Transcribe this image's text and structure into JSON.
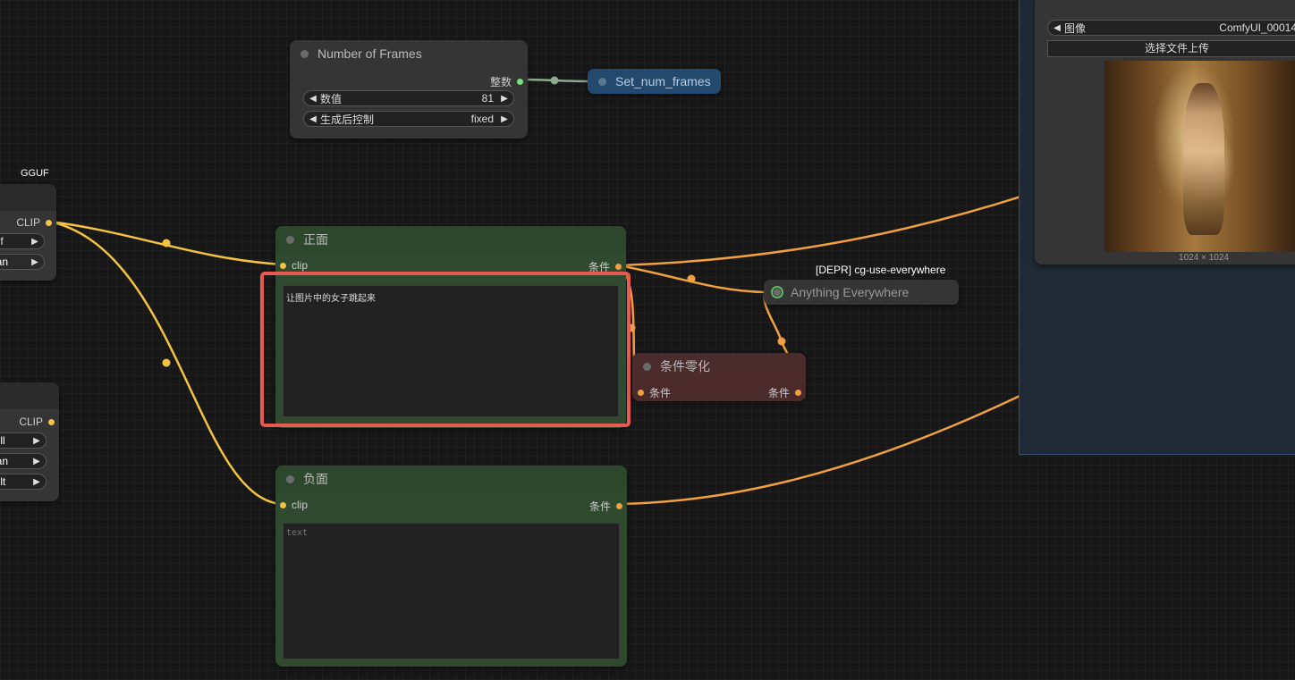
{
  "colors": {
    "background": "#171717",
    "node_gray": "#353535",
    "node_green": "#2f4a2f",
    "node_red": "#4a2a2a",
    "node_blue": "#234a6e",
    "wire_clip": "#f5c342",
    "wire_cond": "#f0a040",
    "highlight": "#e85a4f",
    "group_bg": "#1f2a36"
  },
  "left_node_top": {
    "title": "GGUF",
    "output_label": "CLIP",
    "widgets": [
      {
        "value": "guf"
      },
      {
        "value": "wan"
      }
    ]
  },
  "left_node_bottom": {
    "output_label": "CLIP",
    "widgets": [
      {
        "value": "null"
      },
      {
        "value": "wan"
      },
      {
        "value": "ault"
      }
    ]
  },
  "frames_node": {
    "title": "Number of Frames",
    "output_label": "整数",
    "widgets": [
      {
        "name": "数值",
        "value": "81"
      },
      {
        "name": "生成后控制",
        "value": "fixed"
      }
    ]
  },
  "set_node": {
    "title": "Set_num_frames"
  },
  "positive_node": {
    "title": "正面",
    "input_label": "clip",
    "output_label": "条件",
    "text": "让图片中的女子跳起来"
  },
  "negative_node": {
    "title": "负面",
    "input_label": "clip",
    "output_label": "条件",
    "placeholder": "text"
  },
  "zero_node": {
    "title": "条件零化",
    "input_label": "条件",
    "output_label": "条件"
  },
  "everywhere_node": {
    "badge": "[DEPR] cg-use-everywhere",
    "title": "Anything Everywhere"
  },
  "image_node": {
    "widget_name": "图像",
    "widget_value": "ComfyUI_00014",
    "upload_label": "选择文件上传",
    "size_label": "1024 × 1024"
  }
}
